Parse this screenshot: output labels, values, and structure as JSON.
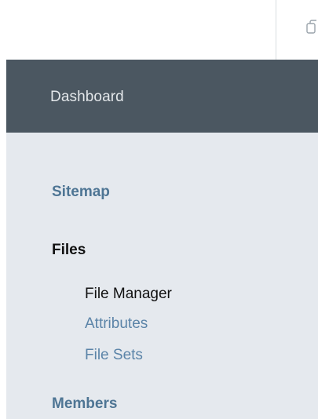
{
  "header": {
    "title": "Dashboard",
    "icon": "copy-icon"
  },
  "nav": {
    "sitemap": "Sitemap",
    "files": "Files",
    "files_items": [
      "File Manager",
      "Attributes",
      "File Sets"
    ],
    "members": "Members"
  },
  "colors": {
    "header_bg": "#4b5761",
    "panel_bg": "#e5e9ee",
    "link": "#5b84a8",
    "active_text": "#111111"
  }
}
